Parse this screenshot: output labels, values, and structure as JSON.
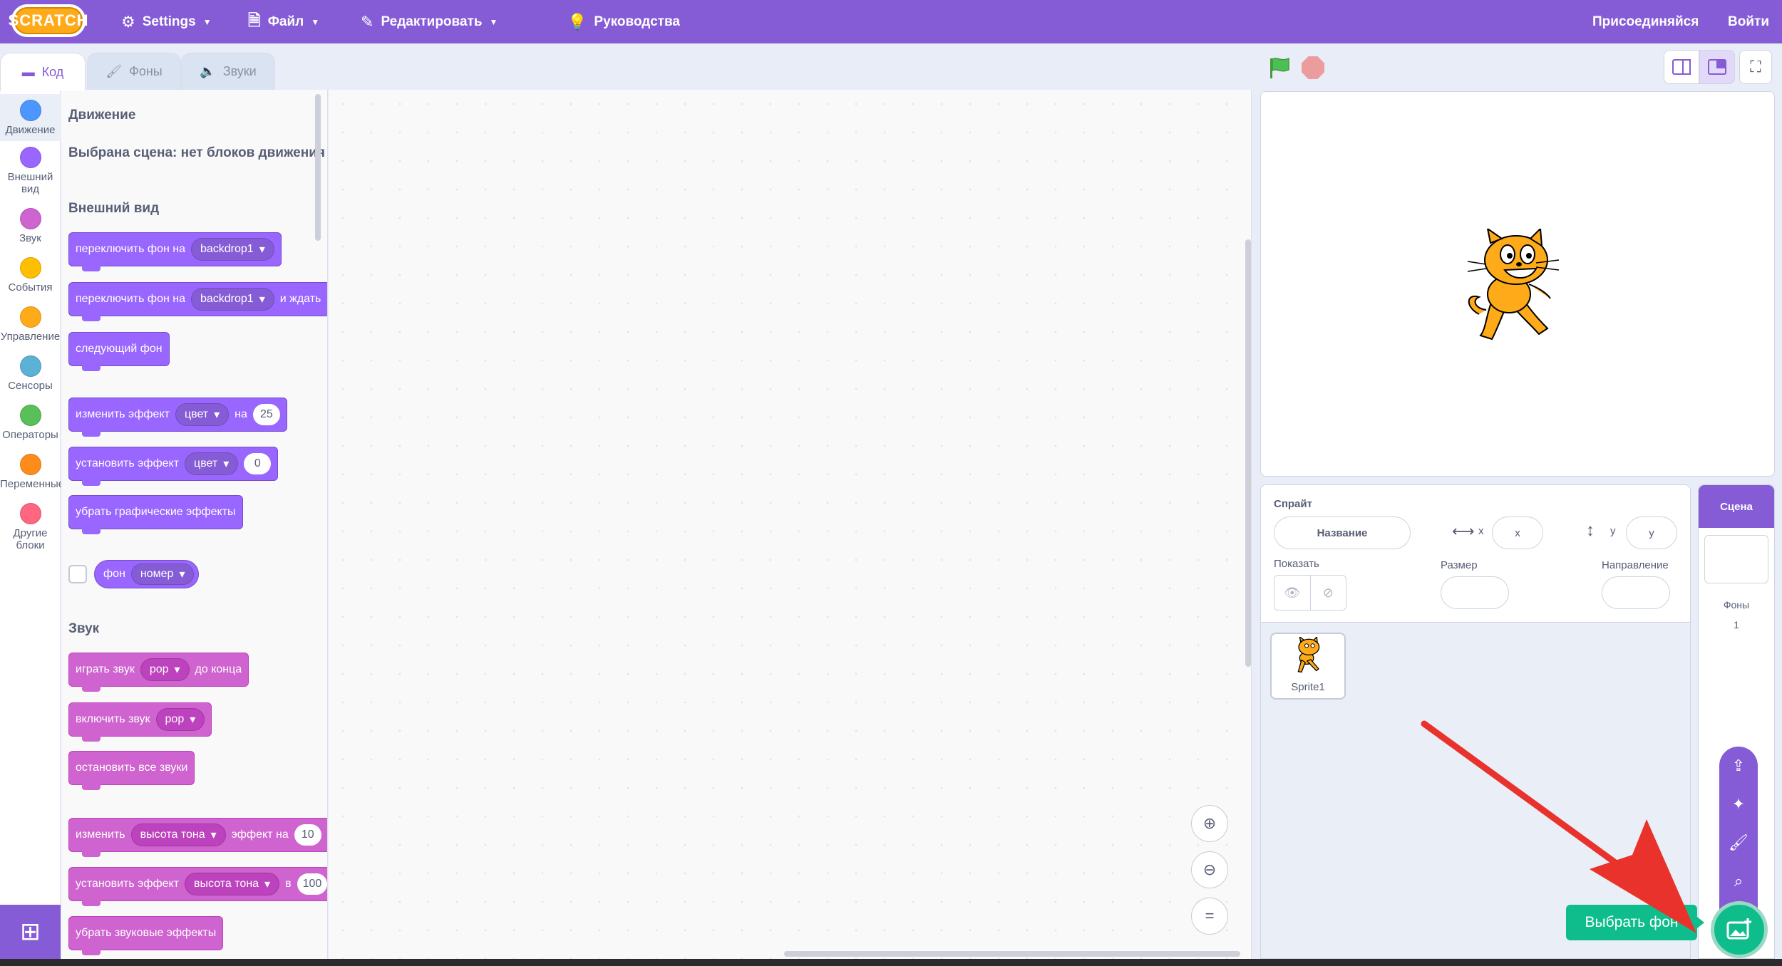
{
  "menubar": {
    "logo": "SCRATCH",
    "settings": "Settings",
    "file": "Файл",
    "edit": "Редактировать",
    "tutorials": "Руководства",
    "join": "Присоединяйся",
    "signin": "Войти"
  },
  "tabs": [
    {
      "label": "Код",
      "active": true
    },
    {
      "label": "Фоны",
      "active": false
    },
    {
      "label": "Звуки",
      "active": false
    }
  ],
  "categories": [
    {
      "label": "Движение",
      "color": "#4c97ff"
    },
    {
      "label": "Внешний вид",
      "color": "#9966ff"
    },
    {
      "label": "Звук",
      "color": "#cf63cf"
    },
    {
      "label": "События",
      "color": "#ffbf00"
    },
    {
      "label": "Управление",
      "color": "#ffab19"
    },
    {
      "label": "Сенсоры",
      "color": "#5cb1d6"
    },
    {
      "label": "Операторы",
      "color": "#59c059"
    },
    {
      "label": "Переменные",
      "color": "#ff8c1a"
    },
    {
      "label": "Другие блоки",
      "color": "#ff6680"
    }
  ],
  "flyout": {
    "motion_heading": "Движение",
    "motion_note": "Выбрана сцена: нет блоков движения",
    "looks_heading": "Внешний вид",
    "sound_heading": "Звук",
    "blocks": {
      "switch_backdrop": {
        "text": "переключить фон на",
        "dd": "backdrop1"
      },
      "switch_backdrop_wait": {
        "text": "переключить фон на",
        "dd": "backdrop1",
        "suffix": "и ждать"
      },
      "next_backdrop": {
        "text": "следующий фон"
      },
      "change_effect": {
        "text": "изменить эффект",
        "dd": "цвет",
        "mid": "на",
        "num": "25"
      },
      "set_effect": {
        "text": "установить эффект",
        "dd": "цвет",
        "num": "0"
      },
      "clear_effects": {
        "text": "убрать графические эффекты"
      },
      "backdrop_reporter": {
        "text": "фон",
        "dd": "номер"
      },
      "play_sound_until": {
        "text": "играть звук",
        "dd": "pop",
        "suffix": "до конца"
      },
      "start_sound": {
        "text": "включить звук",
        "dd": "pop"
      },
      "stop_all_sounds": {
        "text": "остановить все звуки"
      },
      "change_sound_effect": {
        "text": "изменить",
        "dd": "высота тона",
        "mid": "эффект на",
        "num": "10"
      },
      "set_sound_effect": {
        "text": "установить эффект",
        "dd": "высота тона",
        "mid": "в",
        "num": "100"
      },
      "clear_sound_effects": {
        "text": "убрать звуковые эффекты"
      }
    }
  },
  "sprite_info": {
    "sprite_label": "Спрайт",
    "name_placeholder": "Название",
    "x_label": "x",
    "x_value": "x",
    "y_label": "y",
    "y_value": "y",
    "show_label": "Показать",
    "size_label": "Размер",
    "direction_label": "Направление"
  },
  "sprites": [
    {
      "name": "Sprite1"
    }
  ],
  "stage_pane": {
    "title": "Сцена",
    "backdrops_label": "Фоны",
    "backdrops_count": "1"
  },
  "choose_backdrop_tooltip": "Выбрать фон",
  "colors": {
    "accent": "#855cd6",
    "looks": "#9966ff",
    "sound": "#cf63cf",
    "green": "#0fbd8c",
    "annotation_arrow": "#e8322b"
  }
}
